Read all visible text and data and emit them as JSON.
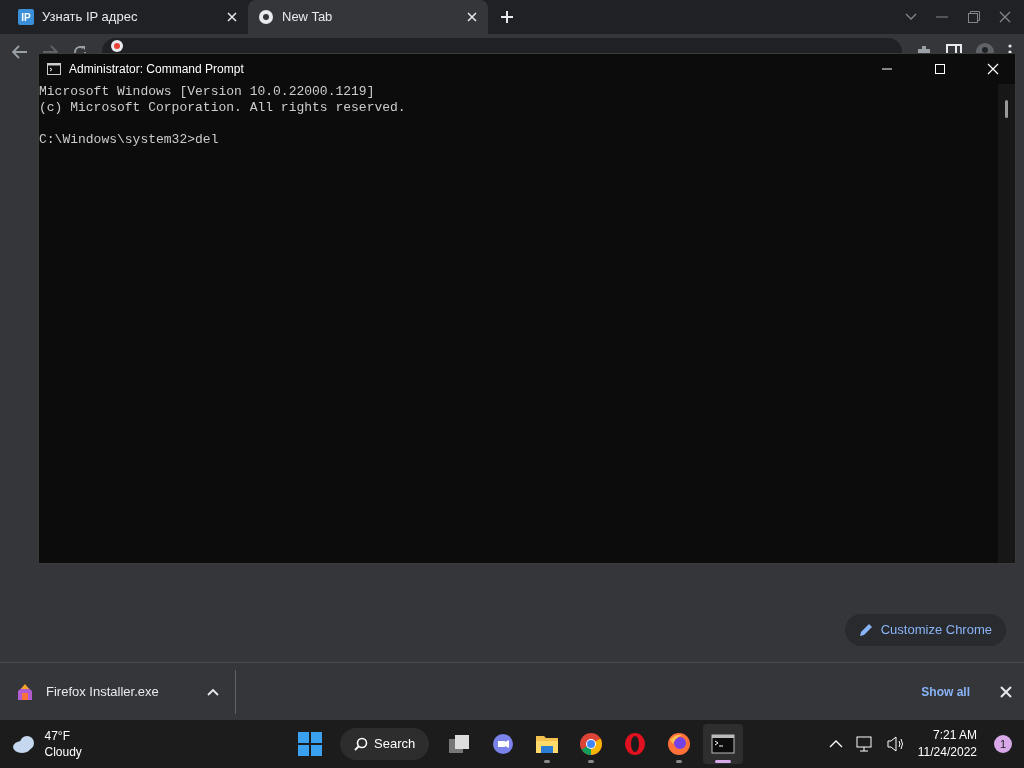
{
  "browser": {
    "tabs": [
      {
        "label": "Узнать IP адрес",
        "icon_text": "IP",
        "selected": false
      },
      {
        "label": "New Tab",
        "selected": true
      }
    ],
    "customize_button": "Customize Chrome",
    "download": {
      "file": "Firefox Installer.exe",
      "show_all": "Show all"
    }
  },
  "cmd_window": {
    "title": "Administrator: Command Prompt",
    "lines": [
      "Microsoft Windows [Version 10.0.22000.1219]",
      "(c) Microsoft Corporation. All rights reserved."
    ],
    "prompt": "C:\\Windows\\system32>del"
  },
  "taskbar": {
    "weather": {
      "temp": "47°F",
      "condition": "Cloudy"
    },
    "search": "Search",
    "apps": [
      {
        "kind": "taskview",
        "running": false,
        "active": false
      },
      {
        "kind": "chat",
        "running": false,
        "active": false
      },
      {
        "kind": "explorer",
        "running": true,
        "active": false
      },
      {
        "kind": "chrome",
        "running": true,
        "active": false
      },
      {
        "kind": "opera",
        "running": false,
        "active": false
      },
      {
        "kind": "firefox",
        "running": true,
        "active": false
      },
      {
        "kind": "cmd",
        "running": true,
        "active": true
      }
    ],
    "time": "7:21 AM",
    "date": "11/24/2022",
    "notifications": "1"
  }
}
